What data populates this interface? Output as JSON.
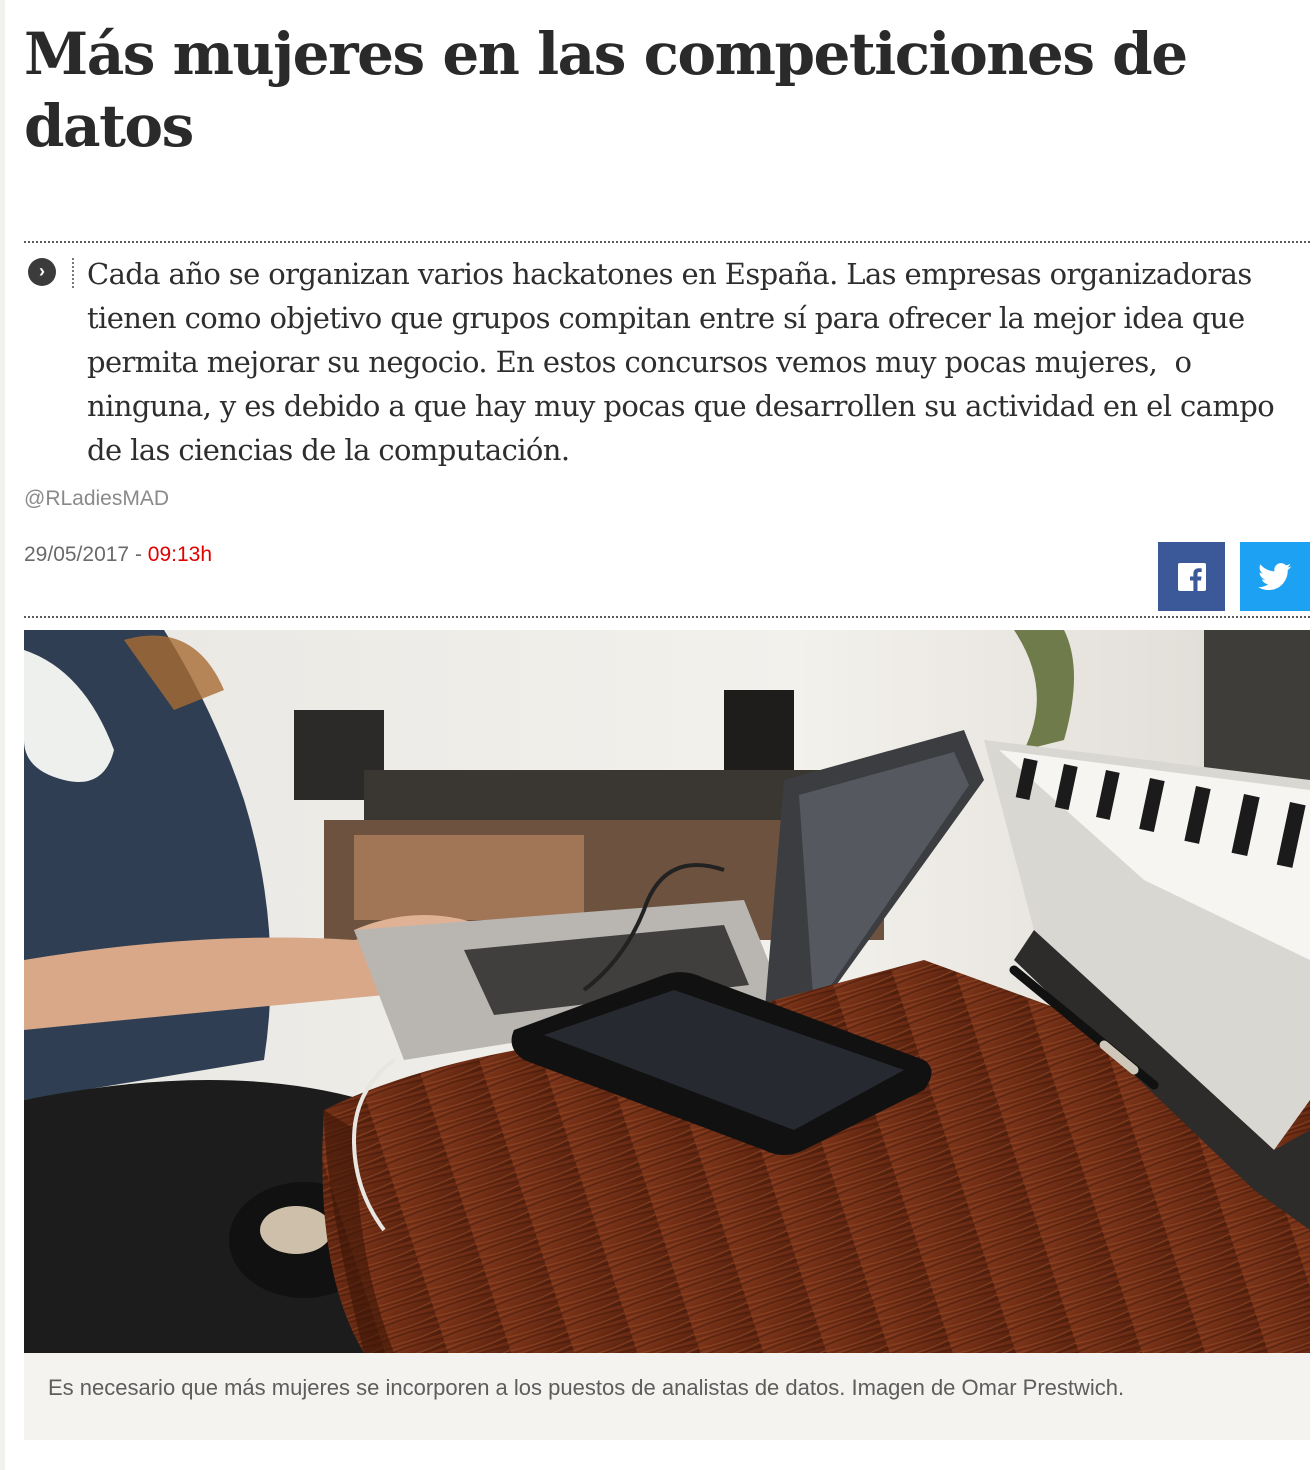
{
  "article": {
    "headline": "Más mujeres en las competiciones de datos",
    "summary": "Cada año se organizan varios hackatones en España. Las empresas organizadoras tienen como objetivo que grupos compitan entre sí para ofrecer la mejor idea que permita mejorar su negocio. En estos concursos vemos muy pocas mujeres,  o ninguna, y es debido a que hay muy pocas que desarrollen su actividad en el campo de las ciencias de la computación.",
    "byline": "@RLadiesMAD",
    "date": "29/05/2017",
    "date_separator": " - ",
    "time": "09:13h",
    "summary_icon": "chevron-right-icon"
  },
  "share": {
    "facebook_icon": "facebook-icon",
    "twitter_icon": "twitter-icon",
    "facebook_color": "#3b5998",
    "twitter_color": "#1da1f2"
  },
  "figure": {
    "caption": "Es necesario que más mujeres se incorporen a los puestos de analistas de datos. Imagen de Omar Prestwich."
  },
  "colors": {
    "accent_time": "#e10000",
    "text": "#2a2a2a",
    "muted": "#8a8a8a"
  }
}
